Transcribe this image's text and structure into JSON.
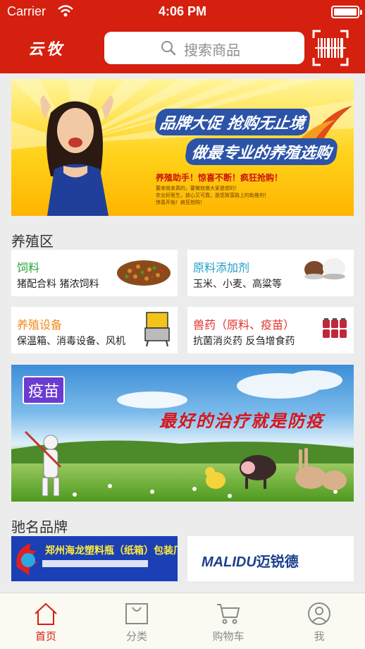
{
  "status_bar": {
    "carrier": "Carrier",
    "time": "4:06 PM"
  },
  "header": {
    "logo": "云牧",
    "search_placeholder": "搜索商品",
    "search_icon": "search-icon",
    "scan_icon": "barcode-scan-icon"
  },
  "banner_top": {
    "headline1": "品牌大促 抢购无止境",
    "headline2": "做最专业的养殖选购",
    "promo_line": "养殖助手！惊喜不断！疯狂抢购！",
    "small_lines": [
      "要来就来真的，要做就做大家是想的！",
      "农业好医生，放心又可靠，是您致富路上的助推剂！",
      "惊喜开始！疯狂抢购！"
    ]
  },
  "sections": {
    "breeding_title": "养殖区",
    "brands_title": "驰名品牌"
  },
  "categories": [
    {
      "title": "饲料",
      "desc": "猪配合料 猪浓饲料",
      "color": "#27a23a"
    },
    {
      "title": "原料添加剂",
      "desc": "玉米、小麦、高粱等",
      "color": "#1fa0c8"
    },
    {
      "title": "养殖设备",
      "desc": "保温箱、消毒设备、风机",
      "color": "#f08a1e"
    },
    {
      "title": "兽药（原料、疫苗）",
      "desc": "抗菌消炎药 反刍增食药",
      "color": "#e0322c"
    }
  ],
  "banner_vaccine": {
    "tag": "疫苗",
    "slogan": "最好的治疗就是防疫"
  },
  "brands": [
    {
      "name": "郑州海龙塑料瓶（纸箱）包装厂"
    },
    {
      "name_en": "MALIDU",
      "name_cn": "迈锐德"
    }
  ],
  "tabbar": [
    {
      "label": "首页",
      "icon": "home-icon",
      "active": true
    },
    {
      "label": "分类",
      "icon": "category-bag-icon",
      "active": false
    },
    {
      "label": "购物车",
      "icon": "cart-icon",
      "active": false
    },
    {
      "label": "我",
      "icon": "profile-icon",
      "active": false
    }
  ],
  "colors": {
    "primary": "#d51f0f",
    "background": "#ececec"
  }
}
